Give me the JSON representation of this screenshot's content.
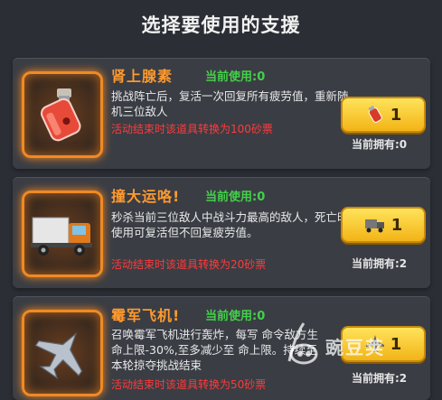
{
  "header": {
    "title": "选择要使用的支援"
  },
  "cards": [
    {
      "name": "肾上腺素",
      "in_use": "当前使用:0",
      "description": "挑战阵亡后，复活一次回复所有疲劳值，重新随机三位敌人",
      "note": "活动结束时该道具转换为100砂票",
      "use_count": "1",
      "owned": "当前拥有:0",
      "icon": "adrenaline-bottle-icon"
    },
    {
      "name": "撞大运咯!",
      "in_use": "当前使用:0",
      "description": "秒杀当前三位敌人中战斗力最高的敌人，死亡时使用可复活但不回复疲劳值。",
      "note": "活动结束时该道具转换为20砂票",
      "use_count": "1",
      "owned": "当前拥有:2",
      "icon": "truck-icon"
    },
    {
      "name": "霉军飞机!",
      "in_use": "当前使用:0",
      "description": "召唤霉军飞机进行轰炸，每写 命令敌方生命上限-30%,至多减少至 命上限。持续至本轮掠夺挑战结束",
      "note": "活动结束时该道具转换为50砂票",
      "use_count": "1",
      "owned": "当前拥有:2",
      "icon": "fighter-jet-icon"
    }
  ],
  "watermark": {
    "text": "豌豆荚"
  },
  "colors": {
    "accent_orange": "#ff9a2e",
    "in_use_green": "#44d04a",
    "note_red": "#ff3b3b",
    "button_yellow": "#f2b417"
  }
}
